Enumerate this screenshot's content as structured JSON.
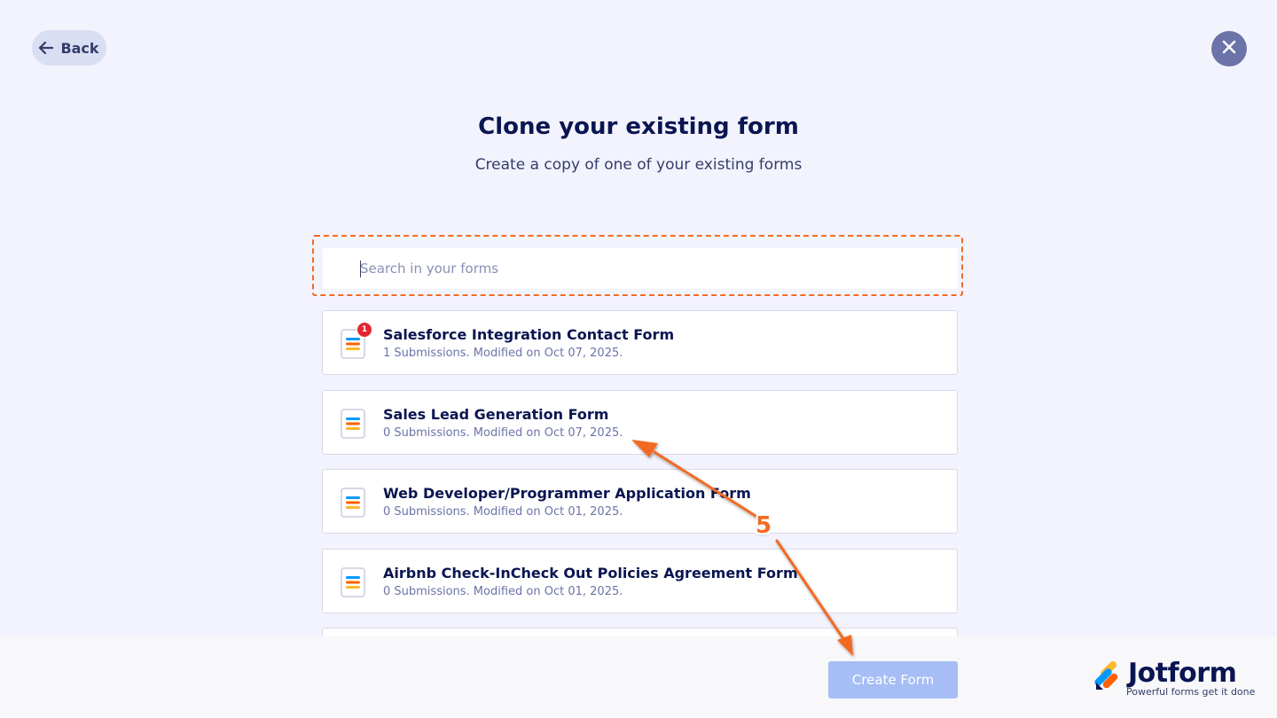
{
  "header": {
    "back_label": "Back",
    "title": "Clone your existing form",
    "subtitle": "Create a copy of one of your existing forms"
  },
  "search": {
    "placeholder": "Search in your forms",
    "value": ""
  },
  "forms": [
    {
      "name": "Salesforce Integration Contact Form",
      "meta": "1 Submissions. Modified on Oct 07, 2025.",
      "badge": "1"
    },
    {
      "name": "Sales Lead Generation Form",
      "meta": "0 Submissions. Modified on Oct 07, 2025.",
      "badge": ""
    },
    {
      "name": "Web Developer/Programmer Application Form",
      "meta": "0 Submissions. Modified on Oct 01, 2025.",
      "badge": ""
    },
    {
      "name": "Airbnb Check-InCheck Out Policies Agreement Form",
      "meta": "0 Submissions. Modified on Oct 01, 2025.",
      "badge": ""
    }
  ],
  "footer": {
    "create_label": "Create Form",
    "logo_text": "Jotform",
    "logo_tagline": "Powerful forms get it done"
  },
  "annotation": {
    "step": "5",
    "color": "#f26b21"
  },
  "icons": {
    "back": "arrow-left-icon",
    "close": "close-icon",
    "form": "form-document-icon",
    "logo": "jotform-logo-icon"
  },
  "colors": {
    "background": "#f3f3fe",
    "title": "#0a1551",
    "create_button": "#a6bdf5",
    "badge": "#e3262f"
  }
}
